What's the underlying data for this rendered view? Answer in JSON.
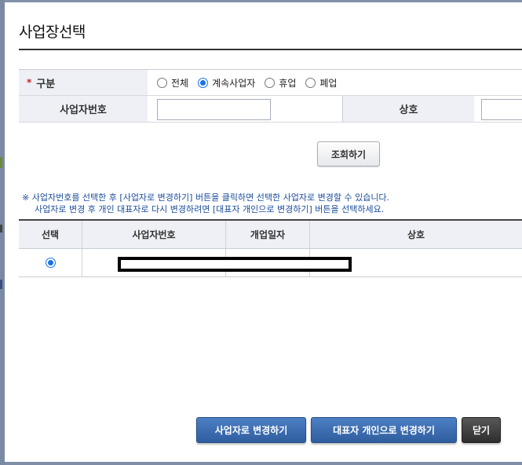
{
  "dialog": {
    "title": "사업장선택"
  },
  "form": {
    "category_label": "구분",
    "required_mark": "*",
    "options": [
      "전체",
      "계속사업자",
      "휴업",
      "폐업"
    ],
    "selected_option": "계속사업자",
    "bizno_label": "사업자번호",
    "bizno_value": "",
    "name_label": "상호",
    "name_value": ""
  },
  "search_button": "조회하기",
  "notice": {
    "line1": "※ 사업자번호를 선택한 후 [사업자로 변경하기] 버튼을 클릭하면 선택한 사업자로 변경할 수 있습니다.",
    "line2": "사업자로 변경 후 개인 대표자로 다시 변경하려면 [대표자 개인으로 변경하기] 버튼을 선택하세요."
  },
  "table": {
    "headers": [
      "선택",
      "사업자번호",
      "개업일자",
      "상호"
    ],
    "rows": [
      {
        "selected": true,
        "bizno": "",
        "open_date": "",
        "name": ""
      }
    ]
  },
  "buttons": {
    "change_to_biz": "사업자로 변경하기",
    "change_to_rep": "대표자 개인으로 변경하기",
    "close": "닫기"
  },
  "colors": {
    "accent_blue": "#2f5e9e",
    "notice_text": "#1b4c9a",
    "radio_selected": "#1a73e8"
  }
}
